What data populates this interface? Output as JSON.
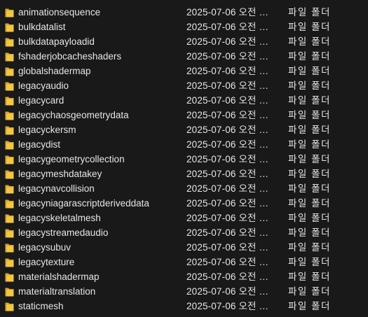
{
  "colors": {
    "background": "#191919",
    "text": "#e6e6e6",
    "folder_back": "#d9a82b",
    "folder_front": "#f2c744"
  },
  "rows": [
    {
      "name": "animationsequence",
      "date": "2025-07-06 오전 …",
      "type": "파일 폴더",
      "icon": "folder-icon"
    },
    {
      "name": "bulkdatalist",
      "date": "2025-07-06 오전 …",
      "type": "파일 폴더",
      "icon": "folder-icon"
    },
    {
      "name": "bulkdatapayloadid",
      "date": "2025-07-06 오전 …",
      "type": "파일 폴더",
      "icon": "folder-icon"
    },
    {
      "name": "fshaderjobcacheshaders",
      "date": "2025-07-06 오전 …",
      "type": "파일 폴더",
      "icon": "folder-icon"
    },
    {
      "name": "globalshadermap",
      "date": "2025-07-06 오전 …",
      "type": "파일 폴더",
      "icon": "folder-icon"
    },
    {
      "name": "legacyaudio",
      "date": "2025-07-06 오전 …",
      "type": "파일 폴더",
      "icon": "folder-icon"
    },
    {
      "name": "legacycard",
      "date": "2025-07-06 오전 …",
      "type": "파일 폴더",
      "icon": "folder-icon"
    },
    {
      "name": "legacychaosgeometrydata",
      "date": "2025-07-06 오전 …",
      "type": "파일 폴더",
      "icon": "folder-icon"
    },
    {
      "name": "legacyckersm",
      "date": "2025-07-06 오전 …",
      "type": "파일 폴더",
      "icon": "folder-icon"
    },
    {
      "name": "legacydist",
      "date": "2025-07-06 오전 …",
      "type": "파일 폴더",
      "icon": "folder-icon"
    },
    {
      "name": "legacygeometrycollection",
      "date": "2025-07-06 오전 …",
      "type": "파일 폴더",
      "icon": "folder-icon"
    },
    {
      "name": "legacymeshdatakey",
      "date": "2025-07-06 오전 …",
      "type": "파일 폴더",
      "icon": "folder-icon"
    },
    {
      "name": "legacynavcollision",
      "date": "2025-07-06 오전 …",
      "type": "파일 폴더",
      "icon": "folder-icon"
    },
    {
      "name": "legacyniagarascriptderiveddata",
      "date": "2025-07-06 오전 …",
      "type": "파일 폴더",
      "icon": "folder-icon"
    },
    {
      "name": "legacyskeletalmesh",
      "date": "2025-07-06 오전 …",
      "type": "파일 폴더",
      "icon": "folder-icon"
    },
    {
      "name": "legacystreamedaudio",
      "date": "2025-07-06 오전 …",
      "type": "파일 폴더",
      "icon": "folder-icon"
    },
    {
      "name": "legacysubuv",
      "date": "2025-07-06 오전 …",
      "type": "파일 폴더",
      "icon": "folder-icon"
    },
    {
      "name": "legacytexture",
      "date": "2025-07-06 오전 …",
      "type": "파일 폴더",
      "icon": "folder-icon"
    },
    {
      "name": "materialshadermap",
      "date": "2025-07-06 오전 …",
      "type": "파일 폴더",
      "icon": "folder-icon"
    },
    {
      "name": "materialtranslation",
      "date": "2025-07-06 오전 …",
      "type": "파일 폴더",
      "icon": "folder-icon"
    },
    {
      "name": "staticmesh",
      "date": "2025-07-06 오전 …",
      "type": "파일 폴더",
      "icon": "folder-icon"
    }
  ]
}
